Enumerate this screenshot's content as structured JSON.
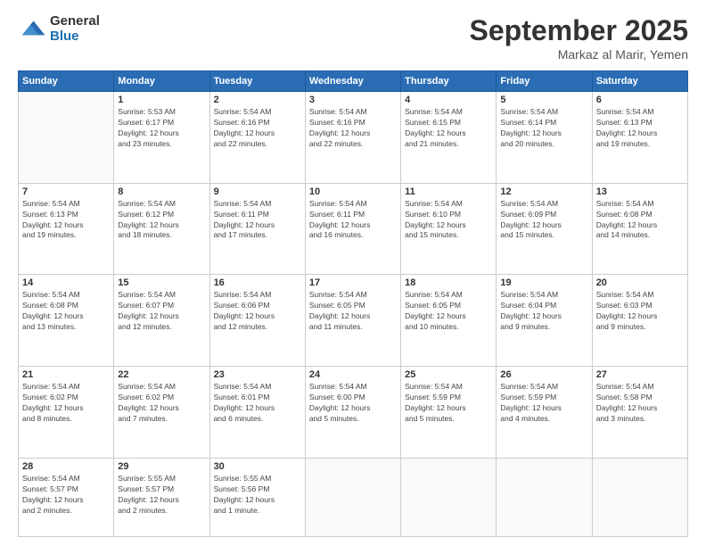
{
  "logo": {
    "general": "General",
    "blue": "Blue"
  },
  "title": "September 2025",
  "location": "Markaz al Marir, Yemen",
  "weekdays": [
    "Sunday",
    "Monday",
    "Tuesday",
    "Wednesday",
    "Thursday",
    "Friday",
    "Saturday"
  ],
  "weeks": [
    [
      {
        "day": "",
        "info": ""
      },
      {
        "day": "1",
        "info": "Sunrise: 5:53 AM\nSunset: 6:17 PM\nDaylight: 12 hours\nand 23 minutes."
      },
      {
        "day": "2",
        "info": "Sunrise: 5:54 AM\nSunset: 6:16 PM\nDaylight: 12 hours\nand 22 minutes."
      },
      {
        "day": "3",
        "info": "Sunrise: 5:54 AM\nSunset: 6:16 PM\nDaylight: 12 hours\nand 22 minutes."
      },
      {
        "day": "4",
        "info": "Sunrise: 5:54 AM\nSunset: 6:15 PM\nDaylight: 12 hours\nand 21 minutes."
      },
      {
        "day": "5",
        "info": "Sunrise: 5:54 AM\nSunset: 6:14 PM\nDaylight: 12 hours\nand 20 minutes."
      },
      {
        "day": "6",
        "info": "Sunrise: 5:54 AM\nSunset: 6:13 PM\nDaylight: 12 hours\nand 19 minutes."
      }
    ],
    [
      {
        "day": "7",
        "info": "Sunrise: 5:54 AM\nSunset: 6:13 PM\nDaylight: 12 hours\nand 19 minutes."
      },
      {
        "day": "8",
        "info": "Sunrise: 5:54 AM\nSunset: 6:12 PM\nDaylight: 12 hours\nand 18 minutes."
      },
      {
        "day": "9",
        "info": "Sunrise: 5:54 AM\nSunset: 6:11 PM\nDaylight: 12 hours\nand 17 minutes."
      },
      {
        "day": "10",
        "info": "Sunrise: 5:54 AM\nSunset: 6:11 PM\nDaylight: 12 hours\nand 16 minutes."
      },
      {
        "day": "11",
        "info": "Sunrise: 5:54 AM\nSunset: 6:10 PM\nDaylight: 12 hours\nand 15 minutes."
      },
      {
        "day": "12",
        "info": "Sunrise: 5:54 AM\nSunset: 6:09 PM\nDaylight: 12 hours\nand 15 minutes."
      },
      {
        "day": "13",
        "info": "Sunrise: 5:54 AM\nSunset: 6:08 PM\nDaylight: 12 hours\nand 14 minutes."
      }
    ],
    [
      {
        "day": "14",
        "info": "Sunrise: 5:54 AM\nSunset: 6:08 PM\nDaylight: 12 hours\nand 13 minutes."
      },
      {
        "day": "15",
        "info": "Sunrise: 5:54 AM\nSunset: 6:07 PM\nDaylight: 12 hours\nand 12 minutes."
      },
      {
        "day": "16",
        "info": "Sunrise: 5:54 AM\nSunset: 6:06 PM\nDaylight: 12 hours\nand 12 minutes."
      },
      {
        "day": "17",
        "info": "Sunrise: 5:54 AM\nSunset: 6:05 PM\nDaylight: 12 hours\nand 11 minutes."
      },
      {
        "day": "18",
        "info": "Sunrise: 5:54 AM\nSunset: 6:05 PM\nDaylight: 12 hours\nand 10 minutes."
      },
      {
        "day": "19",
        "info": "Sunrise: 5:54 AM\nSunset: 6:04 PM\nDaylight: 12 hours\nand 9 minutes."
      },
      {
        "day": "20",
        "info": "Sunrise: 5:54 AM\nSunset: 6:03 PM\nDaylight: 12 hours\nand 9 minutes."
      }
    ],
    [
      {
        "day": "21",
        "info": "Sunrise: 5:54 AM\nSunset: 6:02 PM\nDaylight: 12 hours\nand 8 minutes."
      },
      {
        "day": "22",
        "info": "Sunrise: 5:54 AM\nSunset: 6:02 PM\nDaylight: 12 hours\nand 7 minutes."
      },
      {
        "day": "23",
        "info": "Sunrise: 5:54 AM\nSunset: 6:01 PM\nDaylight: 12 hours\nand 6 minutes."
      },
      {
        "day": "24",
        "info": "Sunrise: 5:54 AM\nSunset: 6:00 PM\nDaylight: 12 hours\nand 5 minutes."
      },
      {
        "day": "25",
        "info": "Sunrise: 5:54 AM\nSunset: 5:59 PM\nDaylight: 12 hours\nand 5 minutes."
      },
      {
        "day": "26",
        "info": "Sunrise: 5:54 AM\nSunset: 5:59 PM\nDaylight: 12 hours\nand 4 minutes."
      },
      {
        "day": "27",
        "info": "Sunrise: 5:54 AM\nSunset: 5:58 PM\nDaylight: 12 hours\nand 3 minutes."
      }
    ],
    [
      {
        "day": "28",
        "info": "Sunrise: 5:54 AM\nSunset: 5:57 PM\nDaylight: 12 hours\nand 2 minutes."
      },
      {
        "day": "29",
        "info": "Sunrise: 5:55 AM\nSunset: 5:57 PM\nDaylight: 12 hours\nand 2 minutes."
      },
      {
        "day": "30",
        "info": "Sunrise: 5:55 AM\nSunset: 5:56 PM\nDaylight: 12 hours\nand 1 minute."
      },
      {
        "day": "",
        "info": ""
      },
      {
        "day": "",
        "info": ""
      },
      {
        "day": "",
        "info": ""
      },
      {
        "day": "",
        "info": ""
      }
    ]
  ]
}
